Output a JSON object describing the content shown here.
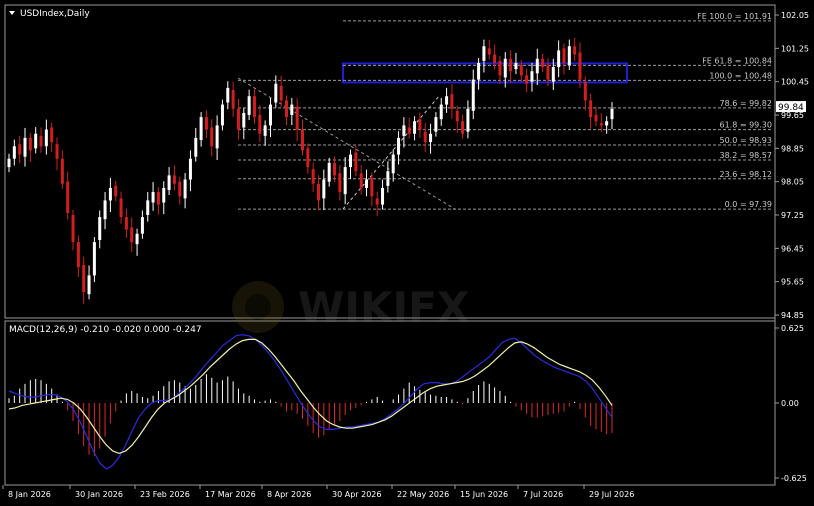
{
  "colors": {
    "background": "#000000",
    "bull_candle": "#ffffff",
    "bear_candle": "#d21e1e",
    "fib_line": "#9a9a9a",
    "fib_text": "#c8c8c8",
    "zone": "#1e1ed2",
    "macd_pos": "#ffffff",
    "macd_neg": "#e02828",
    "macd_main": "#2a2ae0",
    "macd_signal": "#f0f0a8",
    "axis_text": "#ffffff",
    "price_tag_bg": "#ffffff",
    "price_tag_text": "#000000"
  },
  "header": {
    "title": "USDIndex,Daily"
  },
  "macd_header": {
    "title": "MACD(12,26,9) -0.210 -0.020 0.000 -0.247"
  },
  "current_price_label": "99.84",
  "watermark": "WIKIFX",
  "chart_data": [
    {
      "type": "candlestick",
      "title": "USDIndex,Daily",
      "ylim": [
        94.85,
        102.05
      ],
      "y_ticks": [
        "102.05",
        "101.25",
        "100.45",
        "99.65",
        "98.85",
        "98.05",
        "97.25",
        "96.45",
        "95.65",
        "94.85"
      ],
      "x_ticks": [
        "8 Jan 2026",
        "30 Jan 2026",
        "23 Feb 2026",
        "17 Mar 2026",
        "8 Apr 2026",
        "30 Apr 2026",
        "22 May 2026",
        "15 Jun 2026",
        "7 Jul 2026",
        "29 Jul 2026"
      ],
      "current_price": 99.84,
      "closes": [
        98.6,
        98.9,
        98.7,
        99.1,
        98.8,
        99.2,
        98.9,
        99.3,
        99.0,
        98.6,
        98.0,
        97.3,
        96.6,
        96.0,
        95.4,
        95.8,
        96.6,
        97.2,
        97.6,
        97.9,
        97.7,
        97.2,
        96.9,
        96.6,
        96.8,
        97.2,
        97.6,
        97.8,
        97.5,
        97.9,
        98.2,
        98.0,
        97.7,
        98.1,
        98.6,
        99.1,
        99.6,
        99.3,
        98.9,
        99.4,
        99.9,
        100.3,
        99.8,
        99.3,
        99.7,
        100.1,
        99.6,
        99.2,
        99.4,
        99.9,
        100.4,
        100.0,
        99.6,
        99.9,
        99.3,
        98.8,
        98.4,
        98.0,
        97.6,
        98.1,
        98.5,
        98.2,
        97.8,
        98.4,
        98.7,
        98.3,
        97.9,
        98.1,
        97.7,
        97.5,
        97.9,
        98.3,
        98.7,
        99.1,
        99.4,
        99.2,
        99.5,
        99.3,
        99.0,
        99.2,
        99.6,
        99.9,
        100.1,
        99.8,
        99.5,
        99.2,
        99.8,
        100.5,
        100.9,
        101.3,
        101.1,
        100.9,
        100.6,
        101.0,
        100.7,
        100.9,
        100.6,
        100.4,
        100.7,
        101.0,
        100.8,
        100.5,
        100.8,
        101.2,
        100.9,
        101.3,
        101.1,
        100.5,
        100.0,
        99.6,
        99.5,
        99.4,
        99.5,
        99.8
      ],
      "fib_levels": [
        {
          "label": "FE 100.0 = 101.91",
          "value": 101.91
        },
        {
          "label": "FE 61.8 = 100.84",
          "value": 100.84
        },
        {
          "label": "100.0 = 100.48",
          "value": 100.48
        },
        {
          "label": "78.6 = 99.82",
          "value": 99.82
        },
        {
          "label": "61.8 = 99.30",
          "value": 99.3
        },
        {
          "label": "50.0 = 98.93",
          "value": 98.93
        },
        {
          "label": "38.2 = 98.57",
          "value": 98.57
        },
        {
          "label": "23.6 = 98.12",
          "value": 98.12
        },
        {
          "label": "0.0 = 97.39",
          "value": 97.39
        }
      ],
      "zone": {
        "from": 100.48,
        "to": 100.84
      }
    },
    {
      "type": "macd",
      "title": "MACD(12,26,9) -0.210 -0.020 0.000 -0.247",
      "ylim": [
        -0.625,
        0.625
      ],
      "y_ticks": [
        "0.625",
        "0.00",
        "-0.625"
      ],
      "histogram": [
        0.04,
        0.06,
        0.12,
        0.16,
        0.19,
        0.2,
        0.19,
        0.16,
        0.12,
        0.07,
        0.01,
        -0.06,
        -0.15,
        -0.26,
        -0.36,
        -0.43,
        -0.44,
        -0.38,
        -0.28,
        -0.17,
        -0.07,
        0.02,
        0.08,
        0.1,
        0.08,
        0.05,
        0.04,
        0.06,
        0.1,
        0.14,
        0.18,
        0.19,
        0.17,
        0.14,
        0.12,
        0.15,
        0.2,
        0.24,
        0.21,
        0.17,
        0.19,
        0.22,
        0.18,
        0.12,
        0.08,
        0.06,
        0.03,
        0.01,
        0.02,
        0.03,
        0.01,
        -0.03,
        -0.07,
        -0.06,
        -0.09,
        -0.13,
        -0.19,
        -0.25,
        -0.29,
        -0.27,
        -0.22,
        -0.18,
        -0.15,
        -0.1,
        -0.06,
        -0.04,
        -0.02,
        0.01,
        0.03,
        0.05,
        0.02,
        0.0,
        0.03,
        0.07,
        0.12,
        0.17,
        0.14,
        0.11,
        0.09,
        0.07,
        0.06,
        0.05,
        0.05,
        0.03,
        0.01,
        -0.01,
        0.04,
        0.1,
        0.15,
        0.18,
        0.16,
        0.13,
        0.1,
        0.06,
        0.01,
        -0.03,
        -0.06,
        -0.09,
        -0.12,
        -0.12,
        -0.11,
        -0.1,
        -0.09,
        -0.08,
        -0.07,
        -0.03,
        0.01,
        -0.05,
        -0.12,
        -0.19,
        -0.22,
        -0.24,
        -0.26,
        -0.25
      ],
      "macd_line": [
        0.1,
        0.08,
        0.06,
        0.05,
        0.05,
        0.06,
        0.07,
        0.07,
        0.05,
        0.01,
        -0.06,
        -0.16,
        -0.28,
        -0.4,
        -0.5,
        -0.55,
        -0.52,
        -0.45,
        -0.35,
        -0.23,
        -0.12,
        -0.05,
        0.0,
        0.02,
        0.02,
        0.03,
        0.07,
        0.12,
        0.17,
        0.23,
        0.3,
        0.36,
        0.42,
        0.48,
        0.52,
        0.56,
        0.57,
        0.56,
        0.53,
        0.48,
        0.42,
        0.35,
        0.27,
        0.18,
        0.09,
        0.0,
        -0.08,
        -0.15,
        -0.2,
        -0.22,
        -0.22,
        -0.21,
        -0.2,
        -0.2,
        -0.19,
        -0.18,
        -0.17,
        -0.16,
        -0.13,
        -0.09,
        -0.05,
        0.0,
        0.06,
        0.12,
        0.16,
        0.17,
        0.17,
        0.16,
        0.16,
        0.18,
        0.22,
        0.26,
        0.3,
        0.34,
        0.38,
        0.44,
        0.5,
        0.53,
        0.54,
        0.5,
        0.45,
        0.4,
        0.36,
        0.33,
        0.3,
        0.28,
        0.26,
        0.24,
        0.22,
        0.18,
        0.12,
        0.04,
        -0.04,
        -0.12
      ],
      "signal_line": [
        -0.05,
        -0.04,
        -0.02,
        -0.01,
        0.0,
        0.01,
        0.02,
        0.03,
        0.04,
        0.03,
        0.0,
        -0.05,
        -0.12,
        -0.2,
        -0.28,
        -0.35,
        -0.4,
        -0.42,
        -0.4,
        -0.35,
        -0.28,
        -0.2,
        -0.12,
        -0.05,
        0.0,
        0.03,
        0.06,
        0.1,
        0.14,
        0.19,
        0.24,
        0.3,
        0.35,
        0.4,
        0.45,
        0.49,
        0.52,
        0.53,
        0.53,
        0.5,
        0.45,
        0.39,
        0.32,
        0.25,
        0.18,
        0.1,
        0.03,
        -0.04,
        -0.1,
        -0.15,
        -0.18,
        -0.2,
        -0.21,
        -0.21,
        -0.2,
        -0.19,
        -0.18,
        -0.16,
        -0.14,
        -0.11,
        -0.07,
        -0.03,
        0.01,
        0.05,
        0.09,
        0.12,
        0.14,
        0.15,
        0.16,
        0.17,
        0.18,
        0.2,
        0.23,
        0.27,
        0.31,
        0.36,
        0.41,
        0.46,
        0.5,
        0.51,
        0.49,
        0.46,
        0.42,
        0.38,
        0.35,
        0.32,
        0.3,
        0.28,
        0.26,
        0.23,
        0.19,
        0.13,
        0.06,
        -0.02
      ]
    }
  ]
}
